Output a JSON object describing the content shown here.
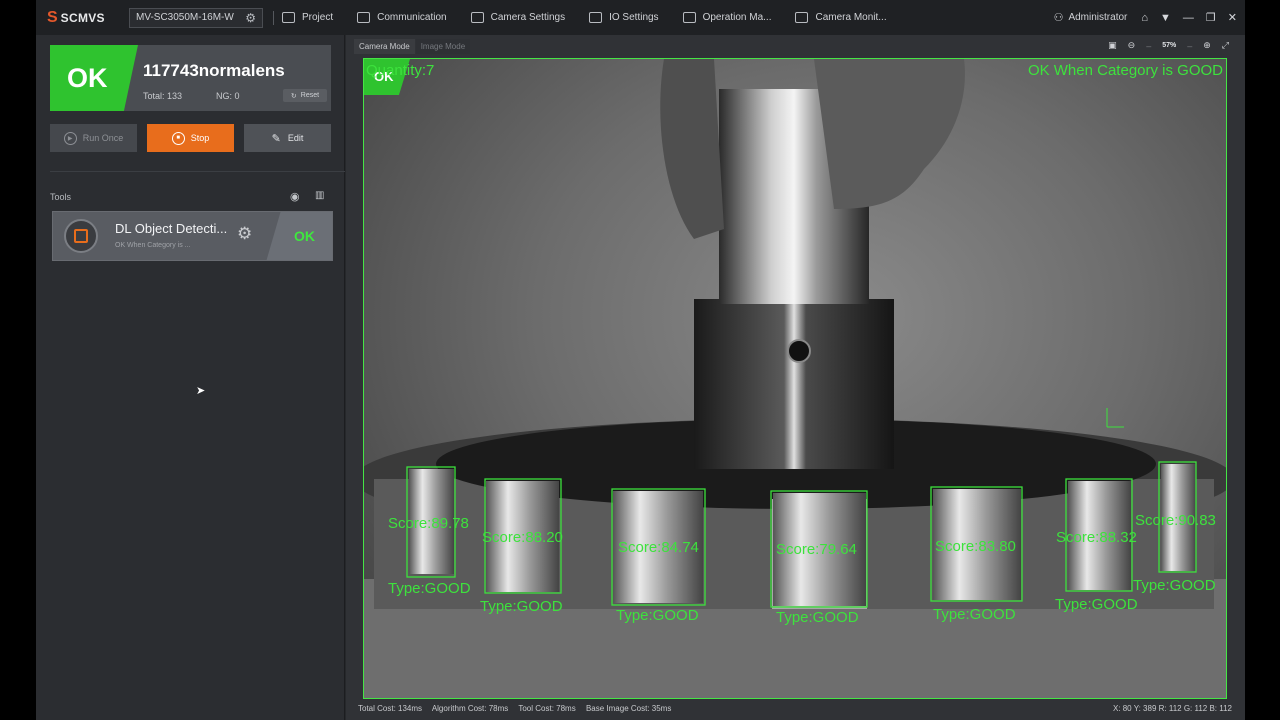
{
  "app": {
    "name": "SCMVS",
    "device": "MV-SC3050M-16M-W"
  },
  "nav": [
    {
      "label": "Project",
      "icon": "project-icon"
    },
    {
      "label": "Communication",
      "icon": "communication-icon"
    },
    {
      "label": "Camera Settings",
      "icon": "camera-icon"
    },
    {
      "label": "IO Settings",
      "icon": "io-icon"
    },
    {
      "label": "Operation Ma...",
      "icon": "operation-icon"
    },
    {
      "label": "Camera Monit...",
      "icon": "monitor-icon"
    }
  ],
  "user": {
    "name": "Administrator"
  },
  "result": {
    "status": "OK",
    "name": "117743normalens",
    "total": "Total: 133",
    "ng": "NG: 0",
    "reset": "Reset"
  },
  "actions": {
    "run_once": "Run Once",
    "stop": "Stop",
    "edit": "Edit"
  },
  "tools": {
    "label": "Tools",
    "items": [
      {
        "name": "DL Object Detecti...",
        "sub": "OK When Category is ...",
        "status": "OK"
      }
    ]
  },
  "viewer": {
    "tabs": [
      "Camera Mode",
      "Image Mode"
    ],
    "zoom": "57%",
    "overlay_status": "OK",
    "quantity": "Quantity:7",
    "rule": "OK When Category is GOOD",
    "detections": [
      {
        "score": "Score:89.78",
        "type": "Type:GOOD"
      },
      {
        "score": "Score:88.20",
        "type": "Type:GOOD"
      },
      {
        "score": "Score:84.74",
        "type": "Type:GOOD"
      },
      {
        "score": "Score:79.64",
        "type": "Type:GOOD"
      },
      {
        "score": "Score:83.80",
        "type": "Type:GOOD"
      },
      {
        "score": "Score:88.32",
        "type": "Type:GOOD"
      },
      {
        "score": "Score:90.83",
        "type": "Type:GOOD"
      }
    ]
  },
  "status_bar": {
    "total_cost": "Total Cost: 134ms",
    "algorithm_cost": "Algorithm Cost: 78ms",
    "tool_cost": "Tool Cost: 78ms",
    "base_image_cost": "Base Image Cost: 35ms",
    "coords": "X: 80 Y: 389   R: 112 G: 112 B: 112"
  },
  "colors": {
    "ok_green": "#2fc32f",
    "stop_orange": "#e86d1c",
    "overlay_green": "#3de23d"
  }
}
